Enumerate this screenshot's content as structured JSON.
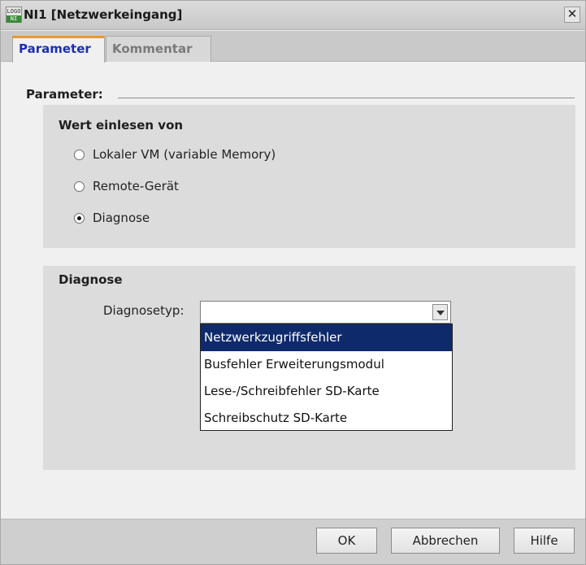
{
  "window": {
    "title": "NI1 [Netzwerkeingang]",
    "icon_text_top": "LOGO",
    "icon_text_bottom": "NI",
    "close_glyph": "✕"
  },
  "tabs": [
    {
      "label": "Parameter",
      "active": true
    },
    {
      "label": "Kommentar",
      "active": false
    }
  ],
  "parameter": {
    "section_label": "Parameter:",
    "source_group": {
      "title": "Wert einlesen von",
      "options": [
        {
          "label": "Lokaler VM (variable Memory)",
          "checked": false
        },
        {
          "label": "Remote-Gerät",
          "checked": false
        },
        {
          "label": "Diagnose",
          "checked": true
        }
      ]
    },
    "diagnose_group": {
      "title": "Diagnose",
      "field_label": "Diagnosetyp:",
      "selected_value": "",
      "dropdown_options": [
        {
          "label": "Netzwerkzugriffsfehler",
          "highlighted": true
        },
        {
          "label": "Busfehler Erweiterungsmodul",
          "highlighted": false
        },
        {
          "label": "Lese-/Schreibfehler SD-Karte",
          "highlighted": false
        },
        {
          "label": "Schreibschutz SD-Karte",
          "highlighted": false
        }
      ]
    }
  },
  "buttons": {
    "ok": "OK",
    "cancel": "Abbrechen",
    "help": "Hilfe"
  },
  "colors": {
    "active_tab_text": "#1b2fb0",
    "active_tab_accent": "#e59a2b",
    "dropdown_highlight": "#0f2a6a",
    "group_background": "#dcdcdc"
  }
}
